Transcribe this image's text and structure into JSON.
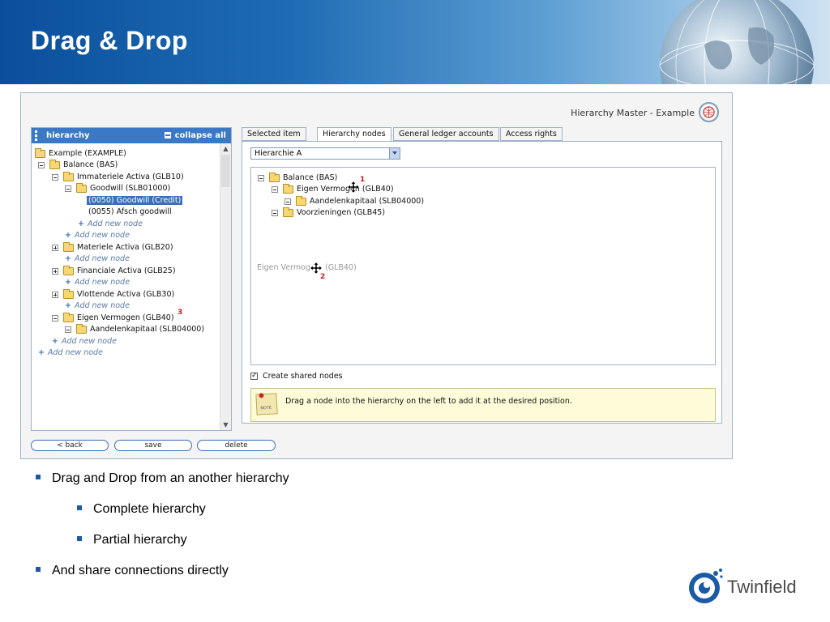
{
  "slide": {
    "title": "Drag & Drop",
    "bullets": [
      {
        "level": 1,
        "text": "Drag and Drop from an another hierarchy"
      },
      {
        "level": 2,
        "text": "Complete hierarchy"
      },
      {
        "level": 2,
        "text": "Partial hierarchy"
      },
      {
        "level": 1,
        "text": "And share connections directly"
      }
    ],
    "logo_text": "Twinfield"
  },
  "app": {
    "title": "Hierarchy Master - Example",
    "left_panel": {
      "title": "hierarchy",
      "collapse_label": "collapse all",
      "tree": [
        {
          "label": "Example (EXAMPLE)",
          "kind": "folder"
        },
        {
          "label": "Balance (BAS)",
          "kind": "folder",
          "toggle": "minus"
        },
        {
          "label": "Immateriele Activa (GLB10)",
          "kind": "folder",
          "toggle": "minus"
        },
        {
          "label": "Goodwill (SLB01000)",
          "kind": "folder",
          "toggle": "minus"
        },
        {
          "label": "(0050) Goodwill (Credit)",
          "kind": "leaf",
          "selected": true
        },
        {
          "label": "(0055) Afsch goodwill",
          "kind": "leaf"
        },
        {
          "label": "Add new node",
          "kind": "add"
        },
        {
          "label": "Add new node",
          "kind": "add"
        },
        {
          "label": "Materiele Activa (GLB20)",
          "kind": "folder",
          "toggle": "plus"
        },
        {
          "label": "Add new node",
          "kind": "add"
        },
        {
          "label": "Financiale Activa (GLB25)",
          "kind": "folder",
          "toggle": "plus"
        },
        {
          "label": "Add new node",
          "kind": "add"
        },
        {
          "label": "Vlottende Activa (GLB30)",
          "kind": "folder",
          "toggle": "plus"
        },
        {
          "label": "Add new node",
          "kind": "add"
        },
        {
          "label": "Eigen Vermogen (GLB40)",
          "kind": "folder",
          "toggle": "minus",
          "marker": "3"
        },
        {
          "label": "Aandelenkapitaal (SLB04000)",
          "kind": "folder",
          "toggle": "minus"
        },
        {
          "label": "Add new node",
          "kind": "add"
        },
        {
          "label": "Add new node",
          "kind": "add"
        }
      ]
    },
    "tabs": [
      "Selected item",
      "Hierarchy nodes",
      "General ledger accounts",
      "Access rights"
    ],
    "active_tab": "Hierarchy nodes",
    "hierarchy_select": "Hierarchie A",
    "right_tree": [
      {
        "label": "Balance (BAS)"
      },
      {
        "label": "Eigen Vermogen (GLB40)",
        "marker": "1"
      },
      {
        "label": "Aandelenkapitaal (SLB04000)"
      },
      {
        "label": "Voorzieningen (GLB45)"
      }
    ],
    "drag_ghost": {
      "label_prefix": "Eigen Vermog",
      "label_suffix": "(GLB40)",
      "marker": "2"
    },
    "create_shared_nodes": {
      "label": "Create shared nodes",
      "checked": true
    },
    "note": {
      "icon_label": "NOTE",
      "text": "Drag a node into the hierarchy on the left to add it at the desired position."
    },
    "buttons": {
      "back": "< back",
      "save": "save",
      "delete": "delete"
    }
  }
}
